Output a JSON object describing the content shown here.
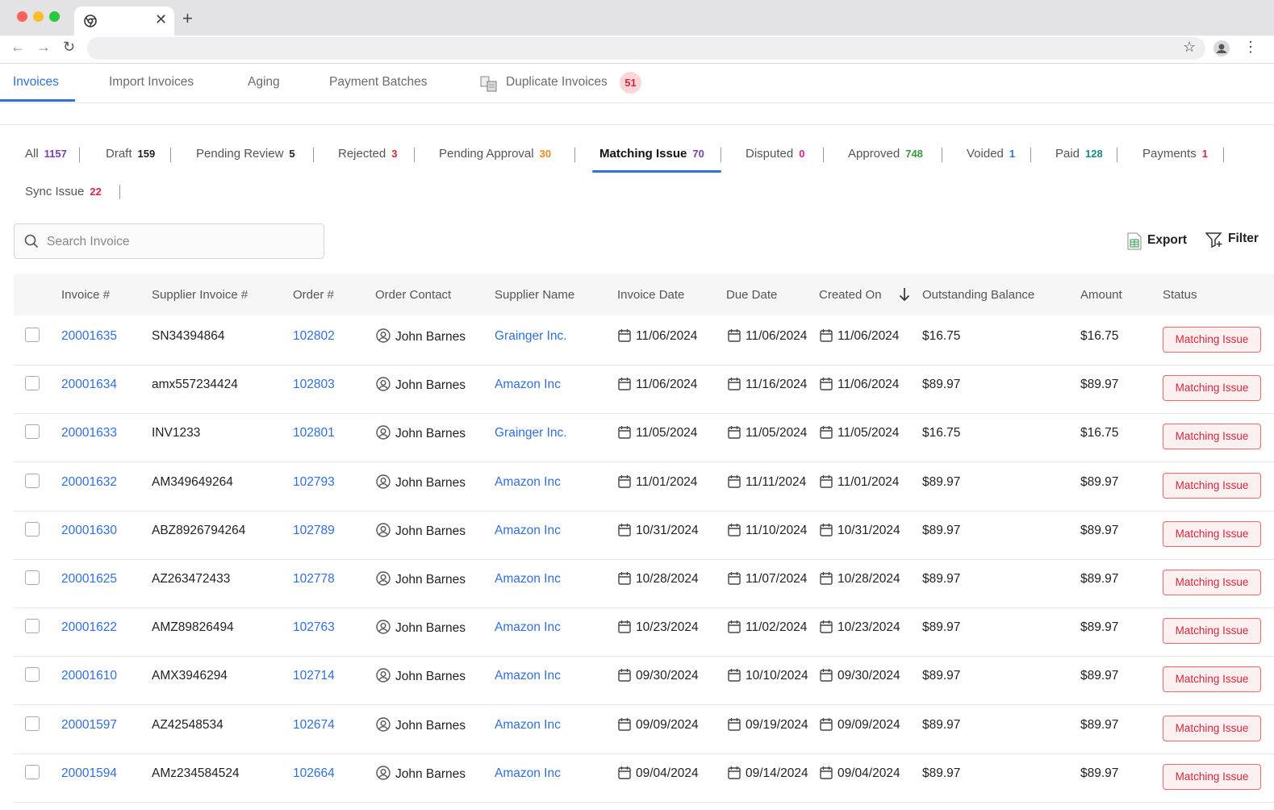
{
  "app_nav": {
    "items": [
      "Invoices",
      "Import Invoices",
      "Aging",
      "Payment Batches",
      "Duplicate Invoices"
    ],
    "duplicate_count": "51"
  },
  "status_tabs": [
    {
      "label": "All",
      "count": "1157",
      "color": "#7b3fb0"
    },
    {
      "label": "Draft",
      "count": "159",
      "color": "#222222"
    },
    {
      "label": "Pending Review",
      "count": "5",
      "color": "#222222"
    },
    {
      "label": "Rejected",
      "count": "3",
      "color": "#d7263d"
    },
    {
      "label": "Pending Approval",
      "count": "30",
      "color": "#e88a1a"
    },
    {
      "label": "Matching Issue",
      "count": "70",
      "color": "#7b3fb0"
    },
    {
      "label": "Disputed",
      "count": "0",
      "color": "#e0218a"
    },
    {
      "label": "Approved",
      "count": "748",
      "color": "#3a9a3a"
    },
    {
      "label": "Voided",
      "count": "1",
      "color": "#2f6fde"
    },
    {
      "label": "Paid",
      "count": "128",
      "color": "#1a8a8a"
    },
    {
      "label": "Payments",
      "count": "1",
      "color": "#d7263d"
    },
    {
      "label": "Sync Issue",
      "count": "22",
      "color": "#d7263d"
    }
  ],
  "search": {
    "placeholder": "Search Invoice"
  },
  "actions": {
    "export": "Export",
    "filter": "Filter"
  },
  "table": {
    "headers": [
      "Invoice #",
      "Supplier Invoice #",
      "Order #",
      "Order Contact",
      "Supplier Name",
      "Invoice Date",
      "Due Date",
      "Created On",
      "Outstanding Balance",
      "Amount",
      "Status"
    ],
    "rows": [
      {
        "invoice": "20001635",
        "supplier_invoice": "SN34394864",
        "order": "102802",
        "contact": "John Barnes",
        "supplier": "Grainger Inc.",
        "invoice_date": "11/06/2024",
        "due_date": "11/06/2024",
        "created_on": "11/06/2024",
        "outstanding": "$16.75",
        "amount": "$16.75",
        "status": "Matching Issue"
      },
      {
        "invoice": "20001634",
        "supplier_invoice": "amx557234424",
        "order": "102803",
        "contact": "John Barnes",
        "supplier": "Amazon Inc",
        "invoice_date": "11/06/2024",
        "due_date": "11/16/2024",
        "created_on": "11/06/2024",
        "outstanding": "$89.97",
        "amount": "$89.97",
        "status": "Matching Issue"
      },
      {
        "invoice": "20001633",
        "supplier_invoice": "INV1233",
        "order": "102801",
        "contact": "John Barnes",
        "supplier": "Grainger Inc.",
        "invoice_date": "11/05/2024",
        "due_date": "11/05/2024",
        "created_on": "11/05/2024",
        "outstanding": "$16.75",
        "amount": "$16.75",
        "status": "Matching Issue"
      },
      {
        "invoice": "20001632",
        "supplier_invoice": "AM349649264",
        "order": "102793",
        "contact": "John Barnes",
        "supplier": "Amazon Inc",
        "invoice_date": "11/01/2024",
        "due_date": "11/11/2024",
        "created_on": "11/01/2024",
        "outstanding": "$89.97",
        "amount": "$89.97",
        "status": "Matching Issue"
      },
      {
        "invoice": "20001630",
        "supplier_invoice": "ABZ8926794264",
        "order": "102789",
        "contact": "John Barnes",
        "supplier": "Amazon Inc",
        "invoice_date": "10/31/2024",
        "due_date": "11/10/2024",
        "created_on": "10/31/2024",
        "outstanding": "$89.97",
        "amount": "$89.97",
        "status": "Matching Issue"
      },
      {
        "invoice": "20001625",
        "supplier_invoice": "AZ263472433",
        "order": "102778",
        "contact": "John Barnes",
        "supplier": "Amazon Inc",
        "invoice_date": "10/28/2024",
        "due_date": "11/07/2024",
        "created_on": "10/28/2024",
        "outstanding": "$89.97",
        "amount": "$89.97",
        "status": "Matching Issue"
      },
      {
        "invoice": "20001622",
        "supplier_invoice": "AMZ89826494",
        "order": "102763",
        "contact": "John Barnes",
        "supplier": "Amazon Inc",
        "invoice_date": "10/23/2024",
        "due_date": "11/02/2024",
        "created_on": "10/23/2024",
        "outstanding": "$89.97",
        "amount": "$89.97",
        "status": "Matching Issue"
      },
      {
        "invoice": "20001610",
        "supplier_invoice": "AMX3946294",
        "order": "102714",
        "contact": "John Barnes",
        "supplier": "Amazon Inc",
        "invoice_date": "09/30/2024",
        "due_date": "10/10/2024",
        "created_on": "09/30/2024",
        "outstanding": "$89.97",
        "amount": "$89.97",
        "status": "Matching Issue"
      },
      {
        "invoice": "20001597",
        "supplier_invoice": "AZ42548534",
        "order": "102674",
        "contact": "John Barnes",
        "supplier": "Amazon Inc",
        "invoice_date": "09/09/2024",
        "due_date": "09/19/2024",
        "created_on": "09/09/2024",
        "outstanding": "$89.97",
        "amount": "$89.97",
        "status": "Matching Issue"
      },
      {
        "invoice": "20001594",
        "supplier_invoice": "AMz234584524",
        "order": "102664",
        "contact": "John Barnes",
        "supplier": "Amazon Inc",
        "invoice_date": "09/04/2024",
        "due_date": "09/14/2024",
        "created_on": "09/04/2024",
        "outstanding": "$89.97",
        "amount": "$89.97",
        "status": "Matching Issue"
      }
    ]
  },
  "icons": [
    "chrome-icon",
    "close-icon",
    "plus-icon",
    "back-icon",
    "forward-icon",
    "reload-icon",
    "star-icon",
    "profile-icon",
    "menu-dots-icon",
    "duplicate-icon",
    "search-icon",
    "spreadsheet-icon",
    "filter-icon",
    "sort-down-icon",
    "calendar-icon",
    "user-circle-icon",
    "checkbox"
  ]
}
